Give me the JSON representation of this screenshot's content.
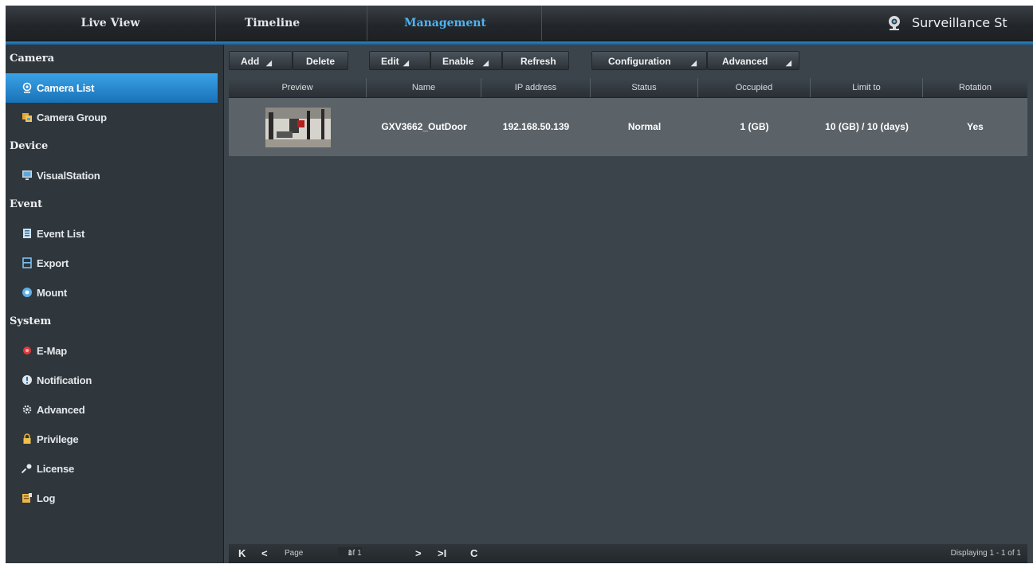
{
  "topnav": {
    "tabs": [
      "Live View",
      "Timeline",
      "Management"
    ],
    "brand": "Surveillance St",
    "active_color": "#4fb3f0"
  },
  "sidebar": {
    "sections": [
      {
        "title": "Camera",
        "items": [
          {
            "label": "Camera List",
            "icon": "camera-icon",
            "active": true
          },
          {
            "label": "Camera Group",
            "icon": "camera-group-icon"
          }
        ]
      },
      {
        "title": "Device",
        "items": [
          {
            "label": "VisualStation",
            "icon": "monitor-icon"
          }
        ]
      },
      {
        "title": "Event",
        "items": [
          {
            "label": "Event List",
            "icon": "list-icon"
          },
          {
            "label": "Export",
            "icon": "export-icon"
          },
          {
            "label": "Mount",
            "icon": "mount-icon"
          }
        ]
      },
      {
        "title": "System",
        "items": [
          {
            "label": "E-Map",
            "icon": "map-pin-icon"
          },
          {
            "label": "Notification",
            "icon": "notification-icon"
          },
          {
            "label": "Advanced",
            "icon": "gear-icon"
          },
          {
            "label": "Privilege",
            "icon": "lock-icon"
          },
          {
            "label": "License",
            "icon": "key-icon"
          },
          {
            "label": "Log",
            "icon": "log-icon"
          }
        ]
      }
    ]
  },
  "toolbar": {
    "add": "Add",
    "delete": "Delete",
    "edit": "Edit",
    "enable": "Enable",
    "refresh": "Refresh",
    "configuration": "Configuration",
    "advanced": "Advanced"
  },
  "table": {
    "columns": [
      "Preview",
      "Name",
      "IP address",
      "Status",
      "Occupied",
      "Limit to",
      "Rotation"
    ],
    "rows": [
      {
        "name": "GXV3662_OutDoor",
        "ip": "192.168.50.139",
        "status": "Normal",
        "occupied": "1 (GB)",
        "limit": "10 (GB) / 10 (days)",
        "rotation": "Yes"
      }
    ]
  },
  "footer": {
    "first": "K",
    "prev": "<",
    "page_label": "Page",
    "page_value": "1",
    "of": "of 1",
    "next": ">",
    "last": ">I",
    "refresh": "C",
    "displaying": "Displaying 1 - 1 of 1"
  }
}
